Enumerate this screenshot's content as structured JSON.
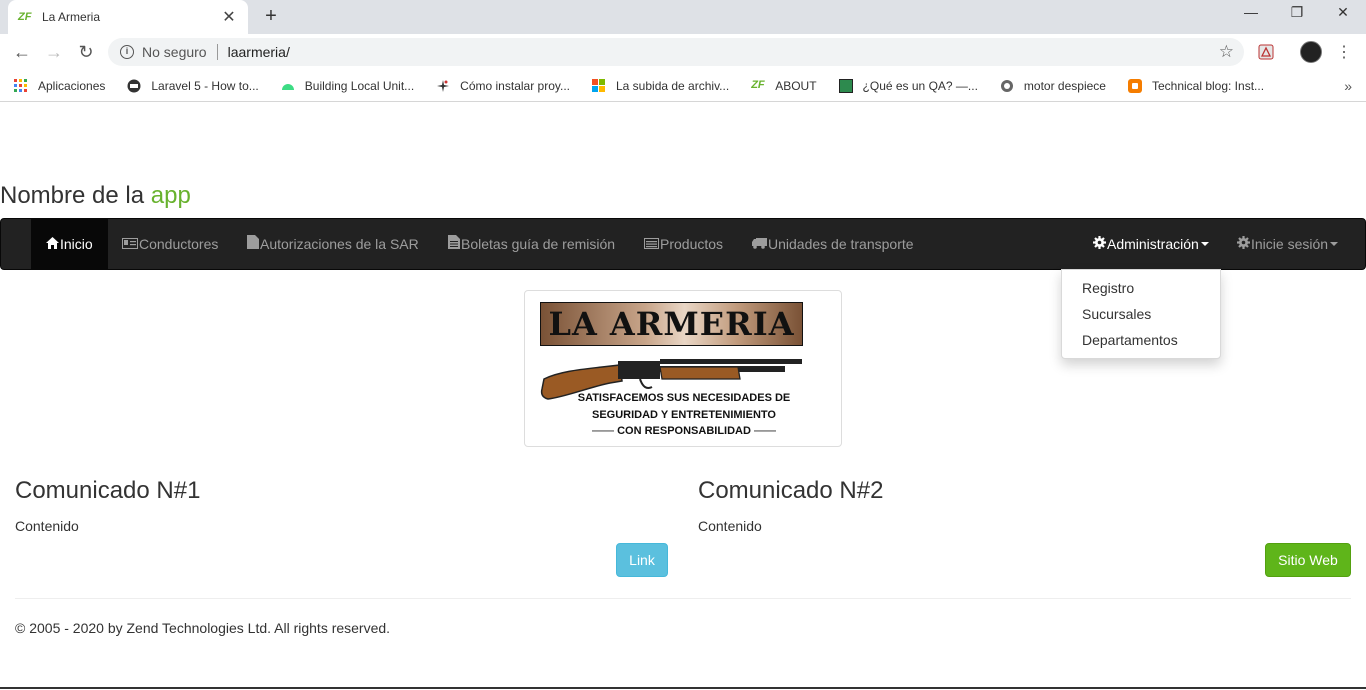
{
  "browser": {
    "tab_title": "La Armeria",
    "tab_favicon": "ZF",
    "new_tab_label": "+",
    "window_controls": [
      "—",
      "❐",
      "✕"
    ],
    "security_label": "No seguro",
    "url": "laarmeria/",
    "bookmarks": [
      {
        "label": "Aplicaciones",
        "icon": "apps-grid-icon"
      },
      {
        "label": "Laravel 5 - How to...",
        "icon": "laravel-icon"
      },
      {
        "label": "Building Local Unit...",
        "icon": "android-icon"
      },
      {
        "label": "Cómo instalar proy...",
        "icon": "star-burst-icon"
      },
      {
        "label": "La subida de archiv...",
        "icon": "windows-icon"
      },
      {
        "label": "ABOUT",
        "icon": "zf-icon"
      },
      {
        "label": "¿Qué es un QA? —...",
        "icon": "green-square-icon"
      },
      {
        "label": "motor despiece",
        "icon": "globe-icon"
      },
      {
        "label": "Technical blog: Inst...",
        "icon": "blogger-icon"
      }
    ],
    "bookmarks_more": "»"
  },
  "app": {
    "title_prefix": "Nombre de la ",
    "title_accent": "app",
    "accent_color": "#68b22e"
  },
  "navbar": {
    "items": [
      {
        "label": "Inicio",
        "icon": "home-icon"
      },
      {
        "label": "Conductores",
        "icon": "id-card-icon"
      },
      {
        "label": "Autorizaciones de la SAR",
        "icon": "file-icon"
      },
      {
        "label": "Boletas guía de remisión",
        "icon": "file-text-icon"
      },
      {
        "label": "Productos",
        "icon": "list-icon"
      },
      {
        "label": "Unidades de transporte",
        "icon": "truck-icon"
      }
    ],
    "right_items": [
      {
        "label": "Administración",
        "icon": "gear-icon"
      },
      {
        "label": "Inicie sesión",
        "icon": "gear-icon"
      }
    ],
    "dropdown": [
      "Registro",
      "Sucursales",
      "Departamentos"
    ]
  },
  "logo": {
    "name": "LA ARMERIA",
    "tagline_1": "SATISFACEMOS SUS NECESIDADES DE",
    "tagline_2": "SEGURIDAD Y ENTRETENIMIENTO",
    "tagline_3": "CON RESPONSABILIDAD"
  },
  "communiques": [
    {
      "title": "Comunicado N#1",
      "content": "Contenido",
      "button": "Link"
    },
    {
      "title": "Comunicado N#2",
      "content": "Contenido",
      "button": "Sitio Web"
    }
  ],
  "footer": "© 2005 - 2020 by Zend Technologies Ltd. All rights reserved."
}
